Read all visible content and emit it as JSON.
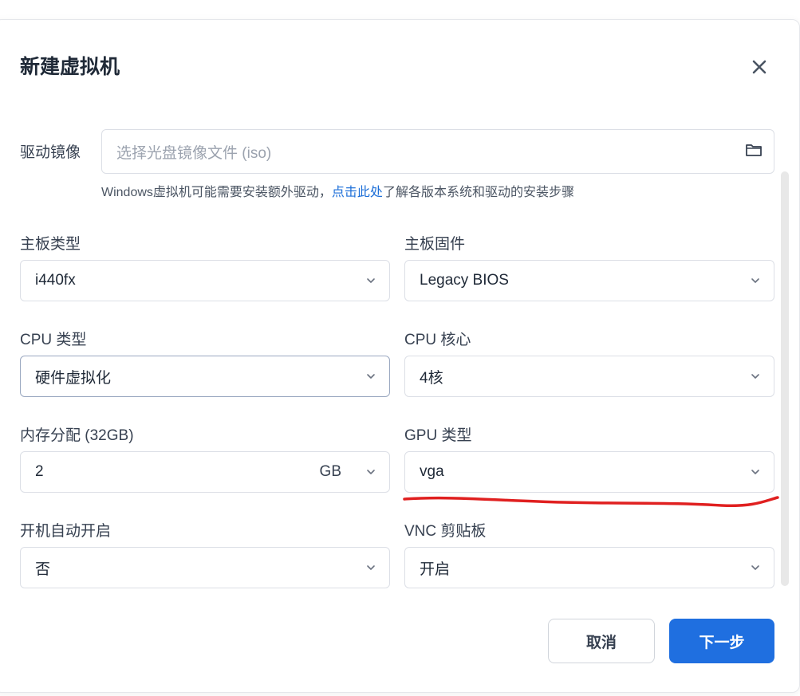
{
  "dialog": {
    "title": "新建虚拟机",
    "close_label": "×"
  },
  "iso": {
    "label": "驱动镜像",
    "placeholder": "选择光盘镜像文件 (iso)",
    "hint_prefix": "Windows虚拟机可能需要安装额外驱动，",
    "hint_link": "点击此处",
    "hint_suffix": "了解各版本系统和驱动的安装步骤"
  },
  "fields": {
    "board_type": {
      "label": "主板类型",
      "value": "i440fx"
    },
    "board_firmware": {
      "label": "主板固件",
      "value": "Legacy BIOS"
    },
    "cpu_type": {
      "label": "CPU 类型",
      "value": "硬件虚拟化"
    },
    "cpu_cores": {
      "label": "CPU 核心",
      "value": "4核"
    },
    "memory": {
      "label": "内存分配 (32GB)",
      "value": "2",
      "unit": "GB"
    },
    "gpu_type": {
      "label": "GPU 类型",
      "value": "vga"
    },
    "autostart": {
      "label": "开机自动开启",
      "value": "否"
    },
    "vnc_clipboard": {
      "label": "VNC 剪贴板",
      "value": "开启"
    }
  },
  "buttons": {
    "cancel": "取消",
    "next": "下一步"
  },
  "colors": {
    "primary": "#1f6fe0",
    "link": "#1d6fd8",
    "annotation": "#e02020"
  }
}
